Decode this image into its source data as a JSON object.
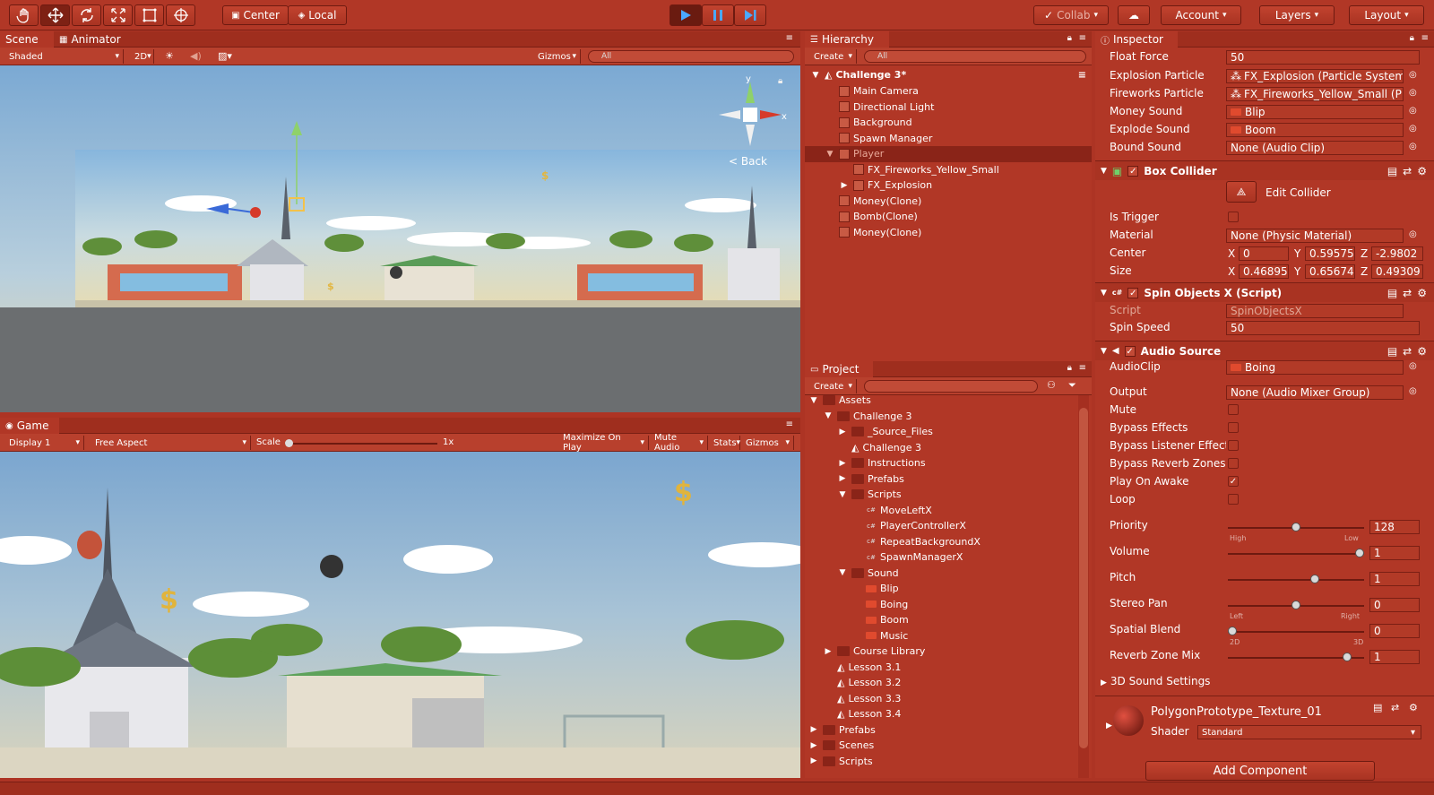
{
  "toolbar": {
    "center_label": "Center",
    "local_label": "Local",
    "collab_label": "Collab",
    "account_label": "Account",
    "layers_label": "Layers",
    "layout_label": "Layout"
  },
  "scene": {
    "tab_scene": "Scene",
    "tab_animator": "Animator",
    "shading": "Shaded",
    "mode_2d": "2D",
    "gizmos": "Gizmos",
    "search_placeholder": "All",
    "back_label": "Back",
    "axis_y": "y",
    "axis_x": "x"
  },
  "game": {
    "tab_label": "Game",
    "display": "Display 1",
    "aspect": "Free Aspect",
    "scale_label": "Scale",
    "scale_value": "1x",
    "maximize": "Maximize On Play",
    "mute": "Mute Audio",
    "stats": "Stats",
    "gizmos": "Gizmos"
  },
  "hierarchy": {
    "tab_label": "Hierarchy",
    "create": "Create",
    "search_placeholder": "All",
    "scene_name": "Challenge 3*",
    "items": [
      {
        "label": "Main Camera",
        "indent": 1,
        "expander": ""
      },
      {
        "label": "Directional Light",
        "indent": 1,
        "expander": ""
      },
      {
        "label": "Background",
        "indent": 1,
        "expander": ""
      },
      {
        "label": "Spawn Manager",
        "indent": 1,
        "expander": ""
      },
      {
        "label": "Player",
        "indent": 1,
        "expander": "▼",
        "selected": true
      },
      {
        "label": "FX_Fireworks_Yellow_Small",
        "indent": 2,
        "expander": ""
      },
      {
        "label": "FX_Explosion",
        "indent": 2,
        "expander": "▶"
      },
      {
        "label": "Money(Clone)",
        "indent": 1,
        "expander": ""
      },
      {
        "label": "Bomb(Clone)",
        "indent": 1,
        "expander": ""
      },
      {
        "label": "Money(Clone)",
        "indent": 1,
        "expander": ""
      }
    ]
  },
  "project": {
    "tab_label": "Project",
    "create": "Create",
    "items": [
      {
        "label": "Assets",
        "indent": 0,
        "expander": "▼",
        "icon": "folder"
      },
      {
        "label": "Challenge 3",
        "indent": 1,
        "expander": "▼",
        "icon": "folder"
      },
      {
        "label": "_Source_Files",
        "indent": 2,
        "expander": "▶",
        "icon": "folder"
      },
      {
        "label": "Challenge 3",
        "indent": 2,
        "expander": "",
        "icon": "unity"
      },
      {
        "label": "Instructions",
        "indent": 2,
        "expander": "▶",
        "icon": "folder"
      },
      {
        "label": "Prefabs",
        "indent": 2,
        "expander": "▶",
        "icon": "folder"
      },
      {
        "label": "Scripts",
        "indent": 2,
        "expander": "▼",
        "icon": "folder"
      },
      {
        "label": "MoveLeftX",
        "indent": 3,
        "expander": "",
        "icon": "script"
      },
      {
        "label": "PlayerControllerX",
        "indent": 3,
        "expander": "",
        "icon": "script"
      },
      {
        "label": "RepeatBackgroundX",
        "indent": 3,
        "expander": "",
        "icon": "script"
      },
      {
        "label": "SpawnManagerX",
        "indent": 3,
        "expander": "",
        "icon": "script"
      },
      {
        "label": "Sound",
        "indent": 2,
        "expander": "▼",
        "icon": "folder"
      },
      {
        "label": "Blip",
        "indent": 3,
        "expander": "",
        "icon": "audio"
      },
      {
        "label": "Boing",
        "indent": 3,
        "expander": "",
        "icon": "audio"
      },
      {
        "label": "Boom",
        "indent": 3,
        "expander": "",
        "icon": "audio"
      },
      {
        "label": "Music",
        "indent": 3,
        "expander": "",
        "icon": "audio"
      },
      {
        "label": "Course Library",
        "indent": 1,
        "expander": "▶",
        "icon": "folder"
      },
      {
        "label": "Lesson 3.1",
        "indent": 1,
        "expander": "",
        "icon": "unity"
      },
      {
        "label": "Lesson 3.2",
        "indent": 1,
        "expander": "",
        "icon": "unity"
      },
      {
        "label": "Lesson 3.3",
        "indent": 1,
        "expander": "",
        "icon": "unity"
      },
      {
        "label": "Lesson 3.4",
        "indent": 1,
        "expander": "",
        "icon": "unity"
      },
      {
        "label": "Prefabs",
        "indent": 0,
        "expander": "▶",
        "icon": "folder"
      },
      {
        "label": "Scenes",
        "indent": 0,
        "expander": "▶",
        "icon": "folder"
      },
      {
        "label": "Scripts",
        "indent": 0,
        "expander": "▶",
        "icon": "folder"
      }
    ]
  },
  "inspector": {
    "tab_label": "Inspector",
    "float_force_label": "Float Force",
    "float_force": "50",
    "explosion_label": "Explosion Particle",
    "explosion": "FX_Explosion (Particle System",
    "fireworks_label": "Fireworks Particle",
    "fireworks": "FX_Fireworks_Yellow_Small (P",
    "money_label": "Money Sound",
    "money": "Blip",
    "explode_label": "Explode Sound",
    "explode": "Boom",
    "bound_label": "Bound Sound",
    "bound": "None (Audio Clip)",
    "box_collider": {
      "title": "Box Collider",
      "edit": "Edit Collider",
      "trigger_label": "Is Trigger",
      "material_label": "Material",
      "material": "None (Physic Material)",
      "center_label": "Center",
      "center_x": "0",
      "center_y": "0.59575",
      "center_z": "-2.9802",
      "size_label": "Size",
      "size_x": "0.46895",
      "size_y": "0.65674",
      "size_z": "0.49309",
      "x": "X",
      "y": "Y",
      "z": "Z"
    },
    "spin": {
      "title": "Spin Objects X (Script)",
      "script_label": "Script",
      "script": "SpinObjectsX",
      "speed_label": "Spin Speed",
      "speed": "50"
    },
    "audio": {
      "title": "Audio Source",
      "clip_label": "AudioClip",
      "clip": "Boing",
      "output_label": "Output",
      "output": "None (Audio Mixer Group)",
      "mute": "Mute",
      "bypass_effects": "Bypass Effects",
      "bypass_listener": "Bypass Listener Effect",
      "bypass_reverb": "Bypass Reverb Zones",
      "play_on_awake": "Play On Awake",
      "loop": "Loop",
      "priority_label": "Priority",
      "priority": "128",
      "priority_level": 0.5,
      "high": "High",
      "low": "Low",
      "volume_label": "Volume",
      "volume": "1",
      "volume_level": 1.0,
      "pitch_label": "Pitch",
      "pitch": "1",
      "pitch_level": 0.65,
      "pan_label": "Stereo Pan",
      "pan": "0",
      "pan_level": 0.5,
      "left": "Left",
      "right": "Right",
      "blend_label": "Spatial Blend",
      "blend": "0",
      "blend_level": 0.0,
      "two_d": "2D",
      "three_d": "3D",
      "reverb_label": "Reverb Zone Mix",
      "reverb": "1",
      "reverb_level": 0.9,
      "sound3d": "3D Sound Settings"
    },
    "material": {
      "name": "PolygonPrototype_Texture_01",
      "shader_label": "Shader",
      "shader": "Standard"
    },
    "add_component": "Add Component"
  }
}
